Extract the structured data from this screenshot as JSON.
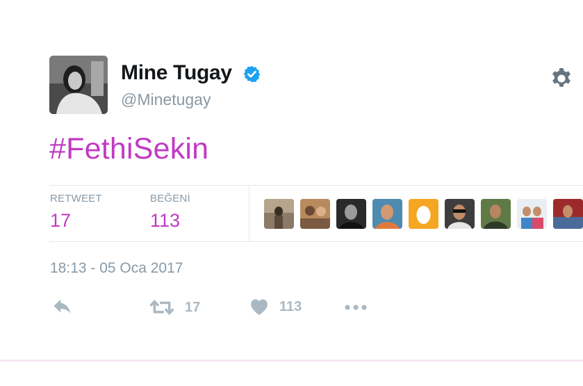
{
  "tweet": {
    "display_name": "Mine Tugay",
    "username": "@Minetugay",
    "text": "#FethiSekin",
    "timestamp": "18:13 - 05 Oca 2017"
  },
  "stats": {
    "retweet_label": "RETWEET",
    "retweet_count": "17",
    "like_label": "BEĞENİ",
    "like_count": "113"
  },
  "actions": {
    "retweet_count": "17",
    "like_count": "113"
  },
  "likers_count": 10,
  "colors": {
    "accent": "#c13ac4",
    "muted": "#8899a6",
    "verified": "#1da1f2",
    "icon": "#aab8c2"
  },
  "icons": [
    "verified-badge-icon",
    "gear-icon",
    "reply-icon",
    "retweet-icon",
    "heart-icon",
    "more-icon"
  ]
}
